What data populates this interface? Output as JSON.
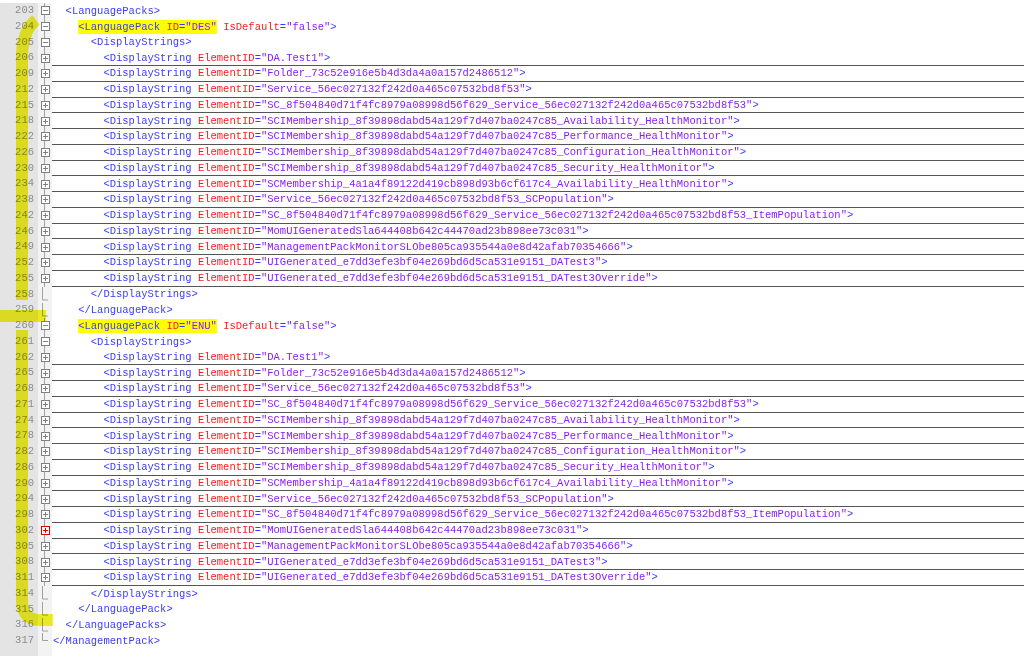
{
  "lines": [
    {
      "number": "203",
      "kind": "open",
      "tag": "<LanguagePacks>",
      "children": [
        {
          "number": "204",
          "kind": "open",
          "tag": "<LanguagePack",
          "tag_marked": true,
          "attributes": [
            {
              "name": "ID",
              "equals": "=",
              "value": "\"DES\"",
              "marked": true
            },
            {
              "name": "IsDefault",
              "equals": "=",
              "value": "\"false\"",
              "marked": false
            }
          ],
          "end": ">",
          "children": [
            {
              "number": "205",
              "kind": "open",
              "tag": "<DisplayStrings>",
              "children": [
                {
                  "number": "206",
                  "kind": "collapsed",
                  "tag": "<DisplayString",
                  "attributes": [
                    {
                      "name": "ElementID",
                      "equals": "=",
                      "value": "\"DA.Test1\""
                    }
                  ],
                  "end": ">"
                },
                {
                  "number": "209",
                  "kind": "collapsed",
                  "tag": "<DisplayString",
                  "attributes": [
                    {
                      "name": "ElementID",
                      "equals": "=",
                      "value": "\"Folder_73c52e916e5b4d3da4a0a157d2486512\""
                    }
                  ],
                  "end": ">"
                },
                {
                  "number": "212",
                  "kind": "collapsed",
                  "tag": "<DisplayString",
                  "attributes": [
                    {
                      "name": "ElementID",
                      "equals": "=",
                      "value": "\"Service_56ec027132f242d0a465c07532bd8f53\""
                    }
                  ],
                  "end": ">"
                },
                {
                  "number": "215",
                  "kind": "collapsed",
                  "tag": "<DisplayString",
                  "attributes": [
                    {
                      "name": "ElementID",
                      "equals": "=",
                      "value": "\"SC_8f504840d71f4fc8979a08998d56f629_Service_56ec027132f242d0a465c07532bd8f53\""
                    }
                  ],
                  "end": ">"
                },
                {
                  "number": "218",
                  "kind": "collapsed",
                  "tag": "<DisplayString",
                  "attributes": [
                    {
                      "name": "ElementID",
                      "equals": "=",
                      "value": "\"SCIMembership_8f39898dabd54a129f7d407ba0247c85_Availability_HealthMonitor\""
                    }
                  ],
                  "end": ">"
                },
                {
                  "number": "222",
                  "kind": "collapsed",
                  "tag": "<DisplayString",
                  "attributes": [
                    {
                      "name": "ElementID",
                      "equals": "=",
                      "value": "\"SCIMembership_8f39898dabd54a129f7d407ba0247c85_Performance_HealthMonitor\""
                    }
                  ],
                  "end": ">"
                },
                {
                  "number": "226",
                  "kind": "collapsed",
                  "tag": "<DisplayString",
                  "attributes": [
                    {
                      "name": "ElementID",
                      "equals": "=",
                      "value": "\"SCIMembership_8f39898dabd54a129f7d407ba0247c85_Configuration_HealthMonitor\""
                    }
                  ],
                  "end": ">"
                },
                {
                  "number": "230",
                  "kind": "collapsed",
                  "tag": "<DisplayString",
                  "attributes": [
                    {
                      "name": "ElementID",
                      "equals": "=",
                      "value": "\"SCIMembership_8f39898dabd54a129f7d407ba0247c85_Security_HealthMonitor\""
                    }
                  ],
                  "end": ">"
                },
                {
                  "number": "234",
                  "kind": "collapsed",
                  "tag": "<DisplayString",
                  "attributes": [
                    {
                      "name": "ElementID",
                      "equals": "=",
                      "value": "\"SCMembership_4a1a4f89122d419cb898d93b6cf617c4_Availability_HealthMonitor\""
                    }
                  ],
                  "end": ">"
                },
                {
                  "number": "238",
                  "kind": "collapsed",
                  "tag": "<DisplayString",
                  "attributes": [
                    {
                      "name": "ElementID",
                      "equals": "=",
                      "value": "\"Service_56ec027132f242d0a465c07532bd8f53_SCPopulation\""
                    }
                  ],
                  "end": ">"
                },
                {
                  "number": "242",
                  "kind": "collapsed",
                  "tag": "<DisplayString",
                  "attributes": [
                    {
                      "name": "ElementID",
                      "equals": "=",
                      "value": "\"SC_8f504840d71f4fc8979a08998d56f629_Service_56ec027132f242d0a465c07532bd8f53_ItemPopulation\""
                    }
                  ],
                  "end": ">"
                },
                {
                  "number": "246",
                  "kind": "collapsed",
                  "tag": "<DisplayString",
                  "attributes": [
                    {
                      "name": "ElementID",
                      "equals": "=",
                      "value": "\"MomUIGeneratedSla644408b642c44470ad23b898ee73c031\""
                    }
                  ],
                  "end": ">"
                },
                {
                  "number": "249",
                  "kind": "collapsed",
                  "tag": "<DisplayString",
                  "attributes": [
                    {
                      "name": "ElementID",
                      "equals": "=",
                      "value": "\"ManagementPackMonitorSLObe805ca935544a0e8d42afab70354666\""
                    }
                  ],
                  "end": ">"
                },
                {
                  "number": "252",
                  "kind": "collapsed",
                  "tag": "<DisplayString",
                  "attributes": [
                    {
                      "name": "ElementID",
                      "equals": "=",
                      "value": "\"UIGenerated_e7dd3efe3bf04e269bd6d5ca531e9151_DATest3\""
                    }
                  ],
                  "end": ">"
                },
                {
                  "number": "255",
                  "kind": "collapsed",
                  "tag": "<DisplayString",
                  "attributes": [
                    {
                      "name": "ElementID",
                      "equals": "=",
                      "value": "\"UIGenerated_e7dd3efe3bf04e269bd6d5ca531e9151_DATest3Override\""
                    }
                  ],
                  "end": ">"
                }
              ]
            },
            {
              "number": "258",
              "kind": "end",
              "tag": "</DisplayStrings>"
            }
          ]
        },
        {
          "number": "259",
          "kind": "end",
          "tag": "</LanguagePack>"
        },
        {
          "number": "260",
          "kind": "open",
          "tag": "<LanguagePack",
          "tag_marked": true,
          "attributes": [
            {
              "name": "ID",
              "equals": "=",
              "value": "\"ENU\"",
              "marked": true
            },
            {
              "name": "IsDefault",
              "equals": "=",
              "value": "\"false\"",
              "marked": false
            }
          ],
          "end": ">",
          "children": [
            {
              "number": "261",
              "kind": "open",
              "tag": "<DisplayStrings>",
              "children": [
                {
                  "number": "262",
                  "kind": "collapsed",
                  "tag": "<DisplayString",
                  "attributes": [
                    {
                      "name": "ElementID",
                      "equals": "=",
                      "value": "\"DA.Test1\""
                    }
                  ],
                  "end": ">"
                },
                {
                  "number": "265",
                  "kind": "collapsed",
                  "tag": "<DisplayString",
                  "attributes": [
                    {
                      "name": "ElementID",
                      "equals": "=",
                      "value": "\"Folder_73c52e916e5b4d3da4a0a157d2486512\""
                    }
                  ],
                  "end": ">"
                },
                {
                  "number": "268",
                  "kind": "collapsed",
                  "tag": "<DisplayString",
                  "attributes": [
                    {
                      "name": "ElementID",
                      "equals": "=",
                      "value": "\"Service_56ec027132f242d0a465c07532bd8f53\""
                    }
                  ],
                  "end": ">"
                },
                {
                  "number": "271",
                  "kind": "collapsed",
                  "tag": "<DisplayString",
                  "attributes": [
                    {
                      "name": "ElementID",
                      "equals": "=",
                      "value": "\"SC_8f504840d71f4fc8979a08998d56f629_Service_56ec027132f242d0a465c07532bd8f53\""
                    }
                  ],
                  "end": ">"
                },
                {
                  "number": "274",
                  "kind": "collapsed",
                  "tag": "<DisplayString",
                  "attributes": [
                    {
                      "name": "ElementID",
                      "equals": "=",
                      "value": "\"SCIMembership_8f39898dabd54a129f7d407ba0247c85_Availability_HealthMonitor\""
                    }
                  ],
                  "end": ">"
                },
                {
                  "number": "278",
                  "kind": "collapsed",
                  "tag": "<DisplayString",
                  "attributes": [
                    {
                      "name": "ElementID",
                      "equals": "=",
                      "value": "\"SCIMembership_8f39898dabd54a129f7d407ba0247c85_Performance_HealthMonitor\""
                    }
                  ],
                  "end": ">"
                },
                {
                  "number": "282",
                  "kind": "collapsed",
                  "tag": "<DisplayString",
                  "attributes": [
                    {
                      "name": "ElementID",
                      "equals": "=",
                      "value": "\"SCIMembership_8f39898dabd54a129f7d407ba0247c85_Configuration_HealthMonitor\""
                    }
                  ],
                  "end": ">"
                },
                {
                  "number": "286",
                  "kind": "collapsed",
                  "tag": "<DisplayString",
                  "attributes": [
                    {
                      "name": "ElementID",
                      "equals": "=",
                      "value": "\"SCIMembership_8f39898dabd54a129f7d407ba0247c85_Security_HealthMonitor\""
                    }
                  ],
                  "end": ">"
                },
                {
                  "number": "290",
                  "kind": "collapsed",
                  "tag": "<DisplayString",
                  "attributes": [
                    {
                      "name": "ElementID",
                      "equals": "=",
                      "value": "\"SCMembership_4a1a4f89122d419cb898d93b6cf617c4_Availability_HealthMonitor\""
                    }
                  ],
                  "end": ">"
                },
                {
                  "number": "294",
                  "kind": "collapsed",
                  "tag": "<DisplayString",
                  "attributes": [
                    {
                      "name": "ElementID",
                      "equals": "=",
                      "value": "\"Service_56ec027132f242d0a465c07532bd8f53_SCPopulation\""
                    }
                  ],
                  "end": ">"
                },
                {
                  "number": "298",
                  "kind": "collapsed",
                  "tag": "<DisplayString",
                  "attributes": [
                    {
                      "name": "ElementID",
                      "equals": "=",
                      "value": "\"SC_8f504840d71f4fc8979a08998d56f629_Service_56ec027132f242d0a465c07532bd8f53_ItemPopulation\""
                    }
                  ],
                  "end": ">"
                },
                {
                  "number": "302",
                  "kind": "collapsed_hot",
                  "tag": "<DisplayString",
                  "attributes": [
                    {
                      "name": "ElementID",
                      "equals": "=",
                      "value": "\"MomUIGeneratedSla644408b642c44470ad23b898ee73c031\""
                    }
                  ],
                  "end": ">"
                },
                {
                  "number": "305",
                  "kind": "collapsed",
                  "tag": "<DisplayString",
                  "attributes": [
                    {
                      "name": "ElementID",
                      "equals": "=",
                      "value": "\"ManagementPackMonitorSLObe805ca935544a0e8d42afab70354666\""
                    }
                  ],
                  "end": ">"
                },
                {
                  "number": "308",
                  "kind": "collapsed",
                  "tag": "<DisplayString",
                  "attributes": [
                    {
                      "name": "ElementID",
                      "equals": "=",
                      "value": "\"UIGenerated_e7dd3efe3bf04e269bd6d5ca531e9151_DATest3\""
                    }
                  ],
                  "end": ">"
                },
                {
                  "number": "311",
                  "kind": "collapsed",
                  "tag": "<DisplayString",
                  "attributes": [
                    {
                      "name": "ElementID",
                      "equals": "=",
                      "value": "\"UIGenerated_e7dd3efe3bf04e269bd6d5ca531e9151_DATest3Override\""
                    }
                  ],
                  "end": ">"
                }
              ]
            },
            {
              "number": "314",
              "kind": "end",
              "tag": "</DisplayStrings>"
            }
          ]
        },
        {
          "number": "315",
          "kind": "end",
          "tag": "</LanguagePack>"
        }
      ]
    },
    {
      "number": "316",
      "kind": "end",
      "tag": "</LanguagePacks>"
    }
  ],
  "closing_line": {
    "number": "317",
    "kind": "last",
    "tag": "</ManagementPack>"
  }
}
